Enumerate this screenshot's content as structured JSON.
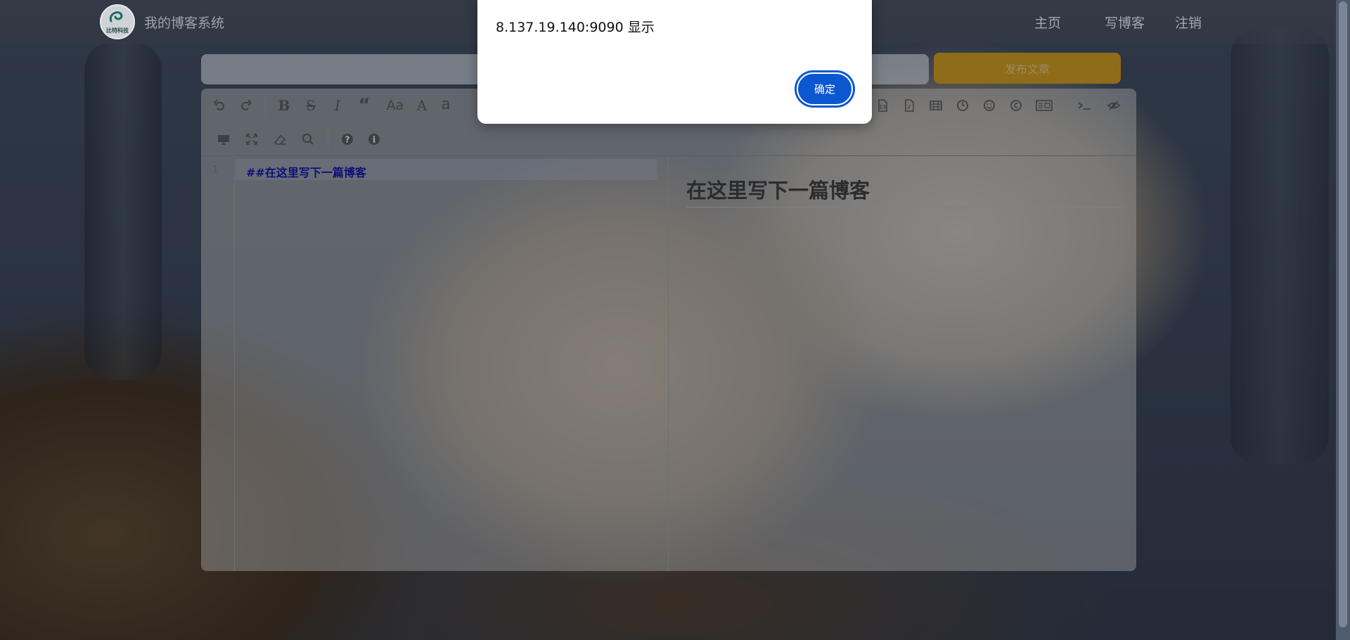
{
  "nav": {
    "logo_text": "比特科技",
    "site_title": "我的博客系统",
    "links": [
      {
        "label": "主页"
      },
      {
        "label": "写博客"
      },
      {
        "label": "注销"
      }
    ]
  },
  "editor": {
    "title_value": "",
    "publish_label": "发布文章",
    "line_number": "1",
    "markdown": "##在这里写下一篇博客",
    "preview_heading": "在这里写下一篇博客"
  },
  "dialog": {
    "message": "8.137.19.140:9090 显示",
    "ok_label": "确定"
  },
  "colors": {
    "accent": "#0b57d0",
    "publish": "#8f6c1a"
  }
}
